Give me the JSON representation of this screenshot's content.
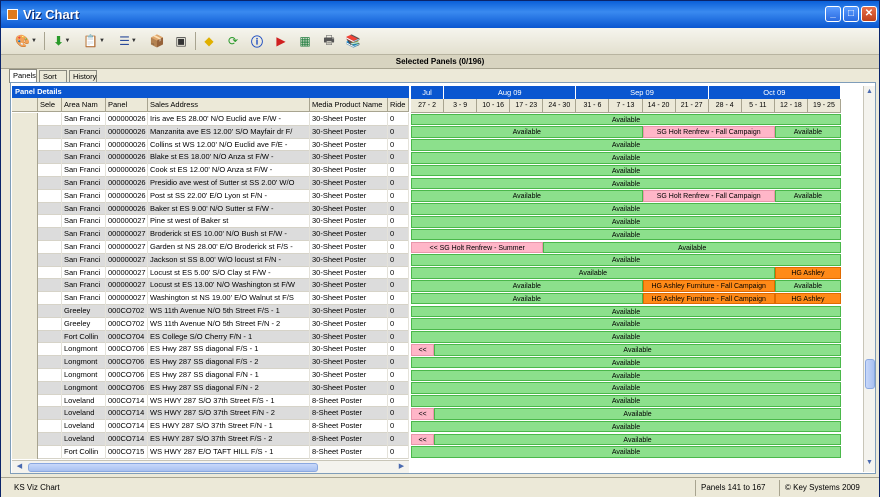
{
  "window": {
    "title": "Viz Chart"
  },
  "toolbar": {
    "icons": [
      "palette-icon",
      "green-arrow-icon",
      "clipboard-icon",
      "list-icon",
      "export-box-icon",
      "calculator-icon",
      "diamond-arrow-icon",
      "refresh-icon",
      "info-icon",
      "filmstrip-arrow-icon",
      "excel-icon",
      "printer-icon",
      "books-icon"
    ]
  },
  "selected_panels": "Selected Panels (0/196)",
  "tabs": [
    "Panels",
    "Sort",
    "History"
  ],
  "grid": {
    "title": "Panel Details",
    "columns": [
      "Sele",
      "Area Nam",
      "Panel",
      "Sales Address",
      "Media Product Name",
      "Ride"
    ],
    "rows": [
      [
        "San Franci",
        "000000026",
        "Iris ave ES 28.00' N/O Euclid ave F/W -",
        "30-Sheet Poster",
        "0"
      ],
      [
        "San Franci",
        "000000026",
        "Manzanita ave ES 12.00' S/O Mayfair dr F/",
        "30-Sheet Poster",
        "0"
      ],
      [
        "San Franci",
        "000000026",
        "Collins st WS 12.00' N/O Euclid ave F/E -",
        "30-Sheet Poster",
        "0"
      ],
      [
        "San Franci",
        "000000026",
        "Blake st ES 18.00' N/O Anza st F/W -",
        "30-Sheet Poster",
        "0"
      ],
      [
        "San Franci",
        "000000026",
        "Cook st ES 12.00' N/O Anza st F/W -",
        "30-Sheet Poster",
        "0"
      ],
      [
        "San Franci",
        "000000026",
        "Presidio ave west of Sutter st SS 2.00' W/O",
        "30-Sheet Poster",
        "0"
      ],
      [
        "San Franci",
        "000000026",
        "Post st SS 22.00' E/O Lyon st F/N -",
        "30-Sheet Poster",
        "0"
      ],
      [
        "San Franci",
        "000000026",
        "Baker st ES 9.00' N/O Sutter st F/W -",
        "30-Sheet Poster",
        "0"
      ],
      [
        "San Franci",
        "000000027",
        "Pine st west of Baker st",
        "30-Sheet Poster",
        "0"
      ],
      [
        "San Franci",
        "000000027",
        "Broderick st ES 10.00' N/O Bush st F/W -",
        "30-Sheet Poster",
        "0"
      ],
      [
        "San Franci",
        "000000027",
        "Garden st NS 28.00' E/O Broderick st F/S -",
        "30-Sheet Poster",
        "0"
      ],
      [
        "San Franci",
        "000000027",
        "Jackson st SS 8.00' W/O locust st F/N -",
        "30-Sheet Poster",
        "0"
      ],
      [
        "San Franci",
        "000000027",
        "Locust st ES 5.00' S/O Clay st F/W -",
        "30-Sheet Poster",
        "0"
      ],
      [
        "San Franci",
        "000000027",
        "Locust st ES 13.00' N/O Washington st F/W",
        "30-Sheet Poster",
        "0"
      ],
      [
        "San Franci",
        "000000027",
        "Washington st NS 19.00' E/O Walnut st F/S",
        "30-Sheet Poster",
        "0"
      ],
      [
        "Greeley",
        "000CO702",
        "WS 11th Avenue  N/O 5th Street F/S - 1",
        "30-Sheet Poster",
        "0"
      ],
      [
        "Greeley",
        "000CO702",
        "WS 11th Avenue  N/O 5th Street F/N - 2",
        "30-Sheet Poster",
        "0"
      ],
      [
        "Fort Collin",
        "000CO704",
        "ES College  S/O Cherry F/N - 1",
        "30-Sheet Poster",
        "0"
      ],
      [
        "Longmont",
        "000CO706",
        "ES Hwy 287 SS  diagonal F/S - 1",
        "30-Sheet Poster",
        "0"
      ],
      [
        "Longmont",
        "000CO706",
        "ES Hwy 287 SS  diagonal F/S - 2",
        "30-Sheet Poster",
        "0"
      ],
      [
        "Longmont",
        "000CO706",
        "ES Hwy 287 SS  diagonal F/N - 1",
        "30-Sheet Poster",
        "0"
      ],
      [
        "Longmont",
        "000CO706",
        "ES Hwy 287 SS  diagonal F/N - 2",
        "30-Sheet Poster",
        "0"
      ],
      [
        "Loveland",
        "000CO714",
        "WS HWY 287  S/O 37th Street F/S - 1",
        "8-Sheet Poster",
        "0"
      ],
      [
        "Loveland",
        "000CO714",
        "WS HWY 287  S/O 37th Street F/N - 2",
        "8-Sheet Poster",
        "0"
      ],
      [
        "Loveland",
        "000CO714",
        "ES HWY 287  S/O 37th Street F/N - 1",
        "8-Sheet Poster",
        "0"
      ],
      [
        "Loveland",
        "000CO714",
        "ES HWY 287  S/O 37th Street F/S - 2",
        "8-Sheet Poster",
        "0"
      ],
      [
        "Fort Collin",
        "000CO715",
        "WS HWY 287  E/O TAFT HILL F/S - 1",
        "8-Sheet Poster",
        "0"
      ]
    ]
  },
  "calendar": {
    "months": [
      "Jul",
      "Aug  09",
      "Sep  09",
      "Oct  09"
    ],
    "weeks": [
      "27 - 2",
      "3 - 9",
      "10 - 16",
      "17 - 23",
      "24 - 30",
      "31 - 6",
      "7 - 13",
      "14 - 20",
      "21 - 27",
      "28 - 4",
      "5 - 11",
      "12 - 18",
      "19 - 25"
    ],
    "colors": {
      "available": "#8ce08c",
      "pink": "#ffb6c8",
      "orange": "#ff8a18"
    },
    "rows": [
      [
        [
          "avail",
          0,
          13,
          "Available"
        ]
      ],
      [
        [
          "avail",
          0,
          7,
          "Available"
        ],
        [
          "pink",
          7,
          11,
          "SG Holt Renfrew - Fall Campaign"
        ],
        [
          "avail",
          11,
          13,
          "Available"
        ]
      ],
      [
        [
          "avail",
          0,
          13,
          "Available"
        ]
      ],
      [
        [
          "avail",
          0,
          13,
          "Available"
        ]
      ],
      [
        [
          "avail",
          0,
          13,
          "Available"
        ]
      ],
      [
        [
          "avail",
          0,
          13,
          "Available"
        ]
      ],
      [
        [
          "avail",
          0,
          7,
          "Available"
        ],
        [
          "pink",
          7,
          11,
          "SG Holt Renfrew - Fall Campaign"
        ],
        [
          "avail",
          11,
          13,
          "Available"
        ]
      ],
      [
        [
          "avail",
          0,
          13,
          "Available"
        ]
      ],
      [
        [
          "avail",
          0,
          13,
          "Available"
        ]
      ],
      [
        [
          "avail",
          0,
          13,
          "Available"
        ]
      ],
      [
        [
          "pink",
          0,
          4,
          "<< SG Holt Renfrew - Summer"
        ],
        [
          "avail",
          4,
          13,
          "Available"
        ]
      ],
      [
        [
          "avail",
          0,
          13,
          "Available"
        ]
      ],
      [
        [
          "avail",
          0,
          11,
          "Available"
        ],
        [
          "orange",
          11,
          13,
          "HG Ashley"
        ]
      ],
      [
        [
          "avail",
          0,
          7,
          "Available"
        ],
        [
          "orange",
          7,
          11,
          "HG Ashley Furniture - Fall Campaign"
        ],
        [
          "avail",
          11,
          13,
          "Available"
        ]
      ],
      [
        [
          "avail",
          0,
          7,
          "Available"
        ],
        [
          "orange",
          7,
          11,
          "HG Ashley Furniture - Fall Campaign"
        ],
        [
          "orange",
          11,
          13,
          "HG Ashley"
        ]
      ],
      [
        [
          "avail",
          0,
          13,
          "Available"
        ]
      ],
      [
        [
          "avail",
          0,
          13,
          "Available"
        ]
      ],
      [
        [
          "avail",
          0,
          13,
          "Available"
        ]
      ],
      [
        [
          "pink",
          0,
          0.7,
          "<<"
        ],
        [
          "avail",
          0.7,
          13,
          "Available"
        ]
      ],
      [
        [
          "avail",
          0,
          13,
          "Available"
        ]
      ],
      [
        [
          "avail",
          0,
          13,
          "Available"
        ]
      ],
      [
        [
          "avail",
          0,
          13,
          "Available"
        ]
      ],
      [
        [
          "avail",
          0,
          13,
          "Available"
        ]
      ],
      [
        [
          "pink",
          0,
          0.7,
          "<<"
        ],
        [
          "avail",
          0.7,
          13,
          "Available"
        ]
      ],
      [
        [
          "avail",
          0,
          13,
          "Available"
        ]
      ],
      [
        [
          "pink",
          0,
          0.7,
          "<<"
        ],
        [
          "avail",
          0.7,
          13,
          "Available"
        ]
      ],
      [
        [
          "avail",
          0,
          13,
          "Available"
        ]
      ]
    ]
  },
  "status": {
    "app": "KS Viz Chart",
    "panels": "Panels 141 to  167",
    "copyright": "© Key Systems 2009"
  }
}
